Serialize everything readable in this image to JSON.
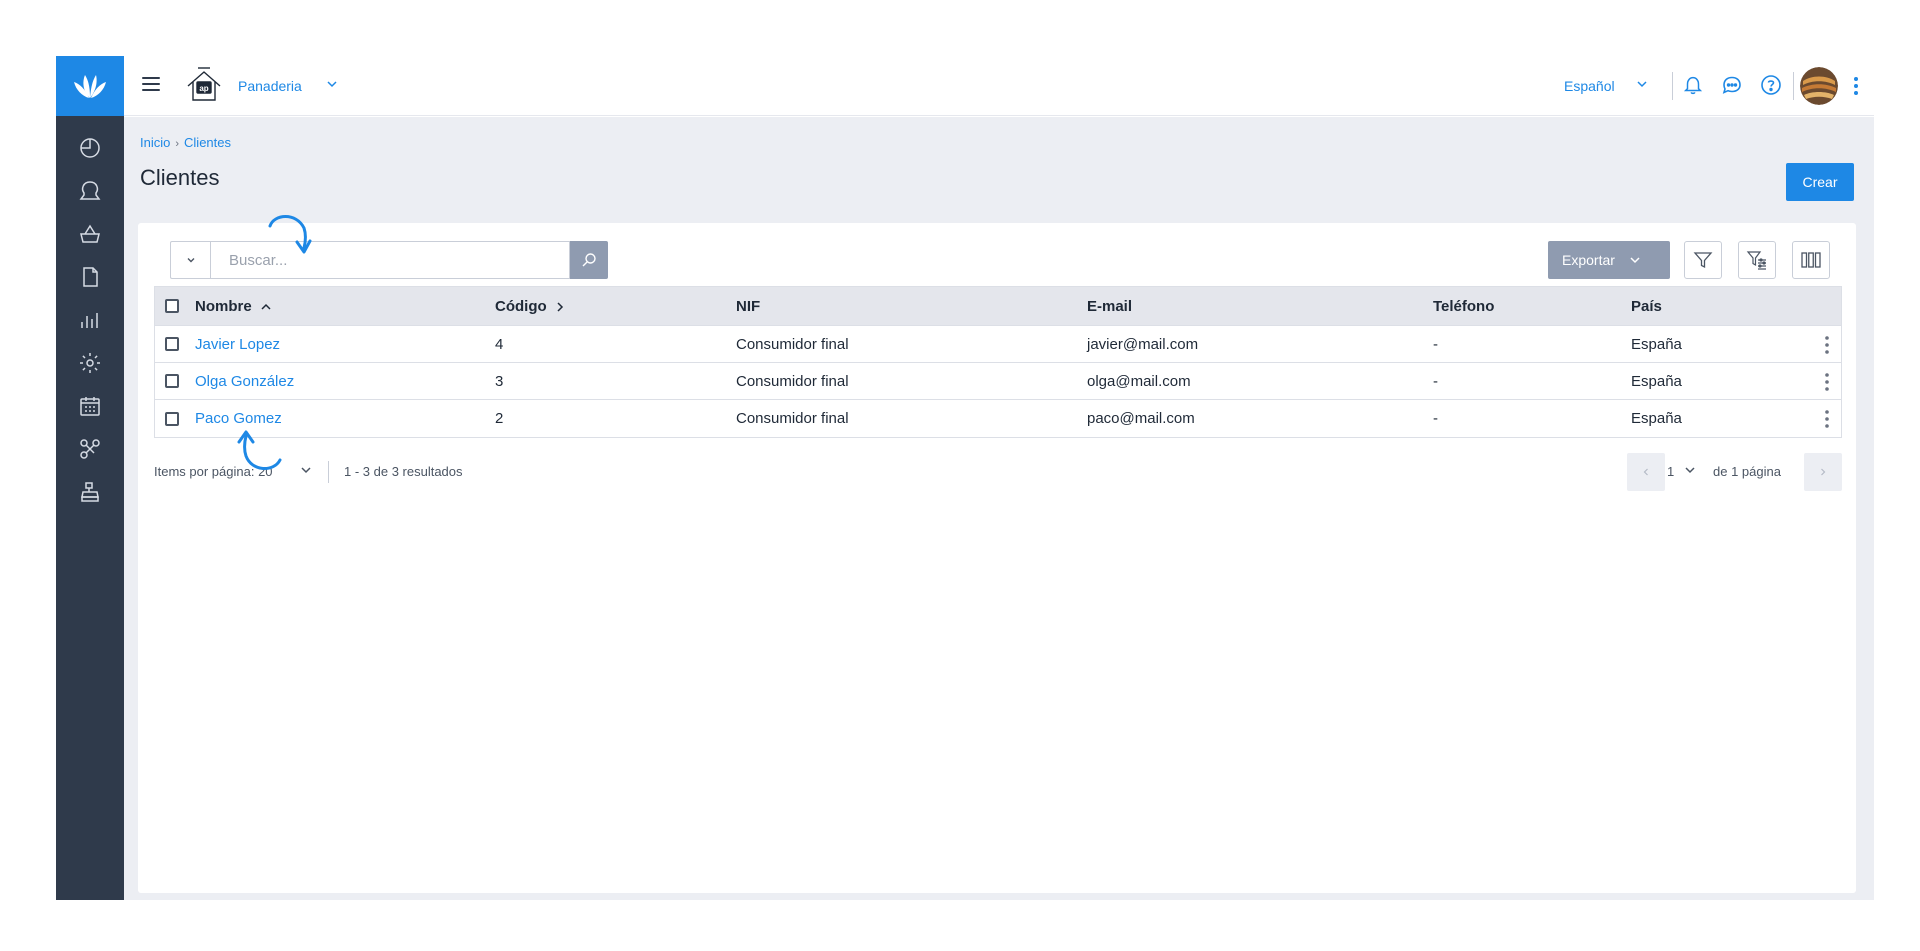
{
  "app": {
    "company_name": "Panaderia",
    "language": "Español",
    "accent_color": "#1e88e5",
    "sidebar_color": "#2f3a4b"
  },
  "sidebar": {
    "logo_icon": "lotus-logo-icon",
    "items": [
      {
        "icon": "dashboard-icon"
      },
      {
        "icon": "user-icon"
      },
      {
        "icon": "basket-icon"
      },
      {
        "icon": "document-icon"
      },
      {
        "icon": "bar-chart-icon"
      },
      {
        "icon": "gear-icon"
      },
      {
        "icon": "calendar-icon"
      },
      {
        "icon": "integrations-icon"
      },
      {
        "icon": "cash-register-icon"
      }
    ]
  },
  "topbar": {
    "icons": [
      "bell-icon",
      "chat-icon",
      "help-icon",
      "avatar",
      "kebab-icon"
    ]
  },
  "breadcrumb": {
    "home": "Inicio",
    "separator": "›",
    "current": "Clientes"
  },
  "page": {
    "title": "Clientes",
    "create_label": "Crear"
  },
  "toolbar": {
    "search_placeholder": "Buscar...",
    "export_label": "Exportar"
  },
  "table": {
    "columns": [
      "Nombre",
      "Código",
      "NIF",
      "E-mail",
      "Teléfono",
      "País"
    ],
    "rows": [
      {
        "nombre": "Javier Lopez",
        "codigo": "4",
        "nif": "Consumidor final",
        "email": "javier@mail.com",
        "telefono": "-",
        "pais": "España"
      },
      {
        "nombre": "Olga González",
        "codigo": "3",
        "nif": "Consumidor final",
        "email": "olga@mail.com",
        "telefono": "-",
        "pais": "España"
      },
      {
        "nombre": "Paco Gomez",
        "codigo": "2",
        "nif": "Consumidor final",
        "email": "paco@mail.com",
        "telefono": "-",
        "pais": "España"
      }
    ]
  },
  "pagination": {
    "items_per_page_label": "Items por página:",
    "items_per_page": "20",
    "results": "1 - 3 de 3 resultados",
    "current_page": "1",
    "of_pages": "de 1 página"
  }
}
